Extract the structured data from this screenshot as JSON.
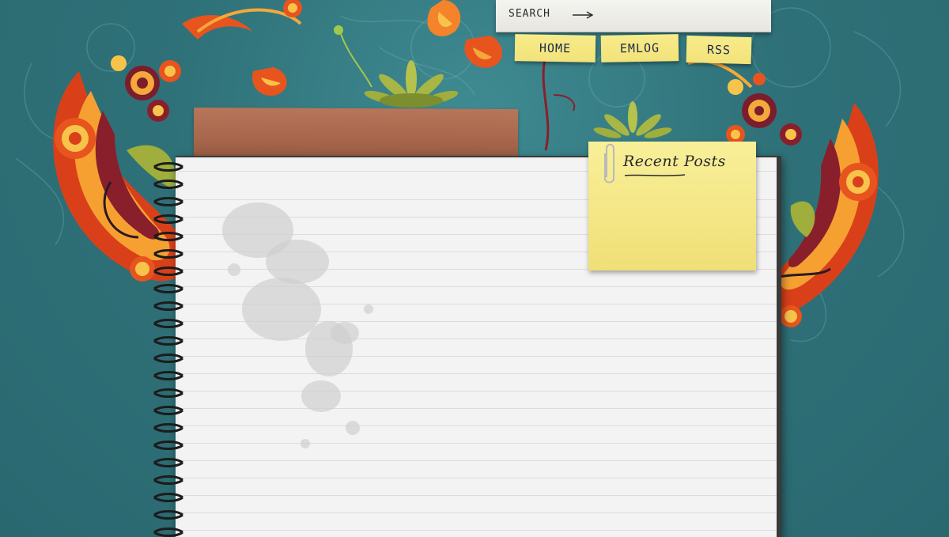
{
  "header": {
    "search_label": "SEARCH"
  },
  "nav": {
    "items": [
      {
        "label": "HOME"
      },
      {
        "label": "EMLOG"
      },
      {
        "label": "RSS"
      }
    ]
  },
  "sidebar": {
    "recent_posts_title": "Recent Posts"
  },
  "icons": {
    "search": "arrow-right-icon",
    "clip": "paperclip-icon"
  },
  "colors": {
    "background": "#2f7178",
    "sticky": "#f4e685",
    "paper": "#f3f3f3",
    "tape": "#a8674c",
    "ornament_orange": "#e8541e",
    "ornament_yellow": "#f3b23a"
  }
}
